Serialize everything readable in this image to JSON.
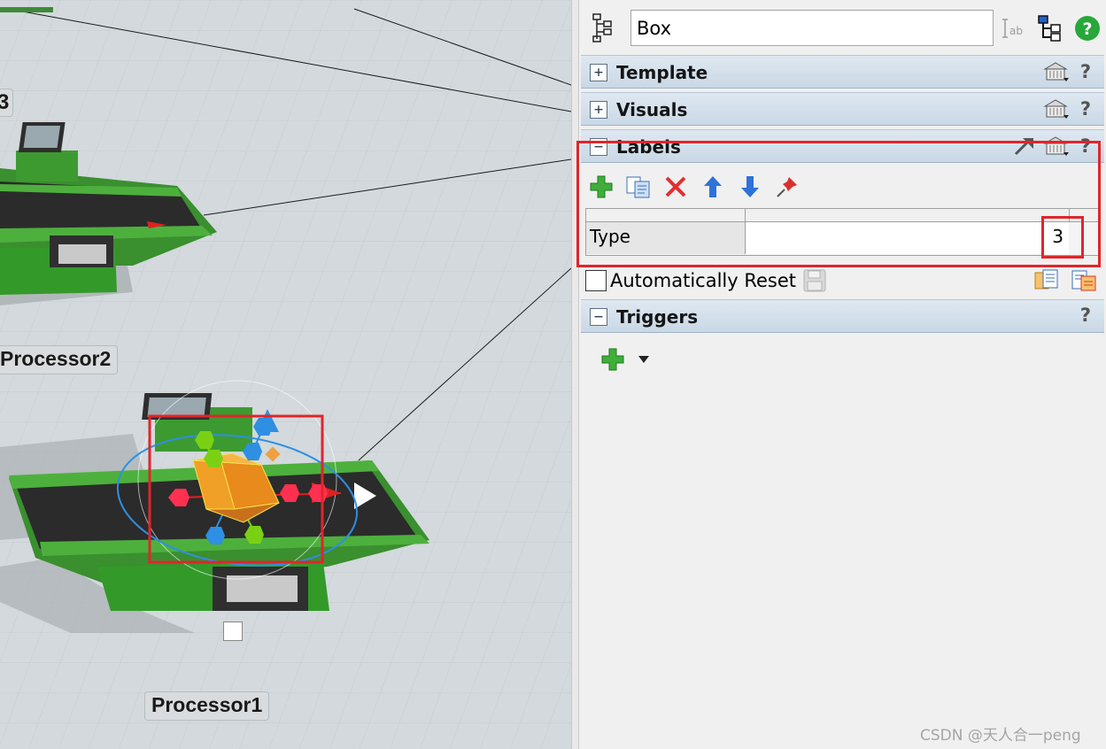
{
  "viewport": {
    "labels": {
      "partial_top": "3",
      "processor2": "Processor2",
      "processor1": "Processor1"
    }
  },
  "properties": {
    "object_name": "Box",
    "sections": {
      "template": {
        "title": "Template",
        "toggle": "+",
        "help": "?"
      },
      "visuals": {
        "title": "Visuals",
        "toggle": "+",
        "help": "?"
      },
      "labels": {
        "title": "Labels",
        "toggle": "−",
        "help": "?"
      },
      "triggers": {
        "title": "Triggers",
        "toggle": "−",
        "help": "?"
      }
    },
    "label_rows": [
      {
        "name": "Type",
        "value": "3"
      }
    ],
    "auto_reset_label": "Automatically Reset",
    "auto_reset_checked": false
  },
  "colors": {
    "highlight": "#e0252b",
    "section_header": "#c9d8e6",
    "machine_green": "#3f9a32"
  },
  "watermark": "CSDN @天人合一peng"
}
